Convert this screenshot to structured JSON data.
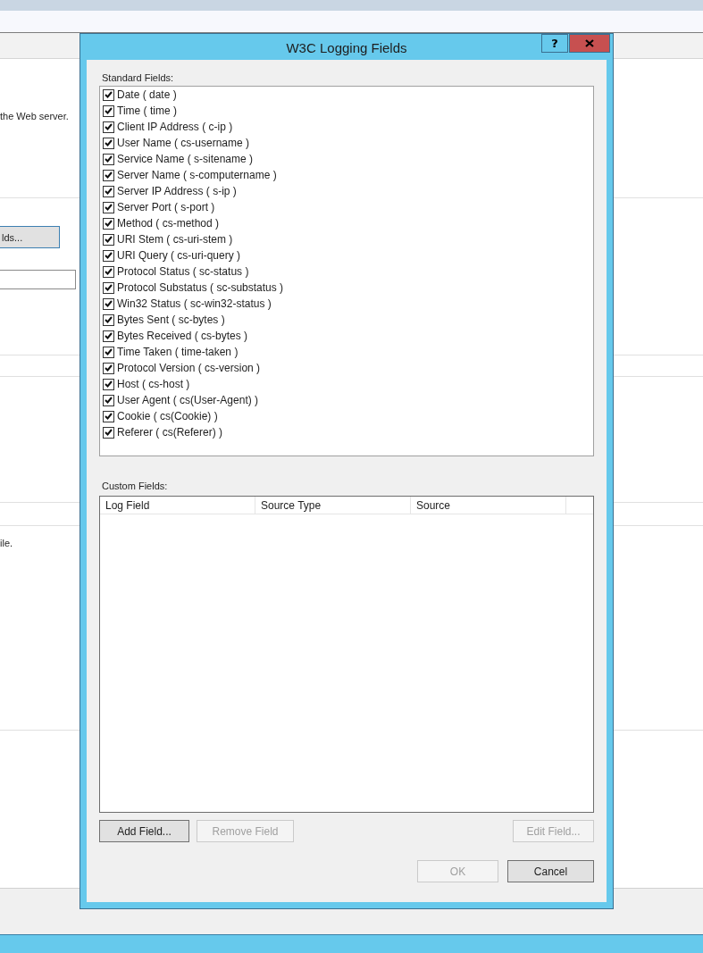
{
  "background_window": {
    "description": "the Web server.",
    "button": "lds...",
    "footer_text": "ile."
  },
  "dialog": {
    "title": "W3C Logging Fields",
    "help_button": "?",
    "standard_fields_label": "Standard Fields:",
    "standard_fields": [
      {
        "label": "Date ( date )",
        "checked": true
      },
      {
        "label": "Time ( time )",
        "checked": true
      },
      {
        "label": "Client IP Address ( c-ip )",
        "checked": true
      },
      {
        "label": "User Name ( cs-username )",
        "checked": true
      },
      {
        "label": "Service Name ( s-sitename )",
        "checked": true
      },
      {
        "label": "Server Name ( s-computername )",
        "checked": true
      },
      {
        "label": "Server IP Address ( s-ip )",
        "checked": true
      },
      {
        "label": "Server Port ( s-port )",
        "checked": true
      },
      {
        "label": "Method ( cs-method )",
        "checked": true
      },
      {
        "label": "URI Stem ( cs-uri-stem )",
        "checked": true
      },
      {
        "label": "URI Query ( cs-uri-query )",
        "checked": true
      },
      {
        "label": "Protocol Status ( sc-status )",
        "checked": true
      },
      {
        "label": "Protocol Substatus ( sc-substatus )",
        "checked": true
      },
      {
        "label": "Win32 Status ( sc-win32-status )",
        "checked": true
      },
      {
        "label": "Bytes Sent ( sc-bytes )",
        "checked": true
      },
      {
        "label": "Bytes Received ( cs-bytes )",
        "checked": true
      },
      {
        "label": "Time Taken ( time-taken )",
        "checked": true
      },
      {
        "label": "Protocol Version ( cs-version )",
        "checked": true
      },
      {
        "label": "Host ( cs-host )",
        "checked": true
      },
      {
        "label": "User Agent ( cs(User-Agent) )",
        "checked": true
      },
      {
        "label": "Cookie ( cs(Cookie) )",
        "checked": true
      },
      {
        "label": "Referer ( cs(Referer) )",
        "checked": true
      }
    ],
    "custom_fields_label": "Custom Fields:",
    "custom_fields_columns": [
      "Log Field",
      "Source Type",
      "Source"
    ],
    "field_buttons": [
      {
        "label": "Add Field...",
        "disabled": false
      },
      {
        "label": "Remove Field",
        "disabled": true
      },
      {
        "label": "Edit Field...",
        "disabled": true
      }
    ],
    "dialog_buttons": [
      {
        "label": "OK",
        "disabled": true
      },
      {
        "label": "Cancel",
        "disabled": false
      }
    ]
  }
}
